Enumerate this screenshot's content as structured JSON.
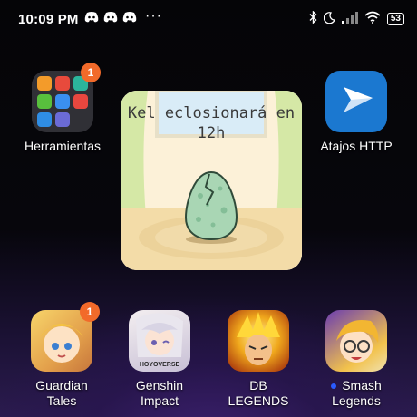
{
  "status_bar": {
    "time": "10:09 PM",
    "dots": "···",
    "battery": "53"
  },
  "apps": {
    "herramientas": {
      "label": "Herramientas",
      "badge": "1",
      "icon": "folder-icon"
    },
    "atajos": {
      "label": "Atajos HTTP",
      "icon": "play-arrow-icon"
    },
    "guardian": {
      "label": "Guardian Tales",
      "badge": "1",
      "icon": "guardian-tales-icon"
    },
    "genshin": {
      "label_line1": "Genshin",
      "label_line2": "Impact",
      "icon": "genshin-impact-icon",
      "icon_text": "HOYOVERSE"
    },
    "db": {
      "label": "DB LEGENDS",
      "icon": "db-legends-icon"
    },
    "smash": {
      "label_line1": "Smash",
      "label_line2": "Legends",
      "icon": "smash-legends-icon"
    }
  },
  "widget": {
    "line1": "Kel eclosionará en",
    "line2": "12h",
    "icon": "egg-icon"
  },
  "colors": {
    "badge": "#f26a2a",
    "widget_bg": "#fcf2dc",
    "atajos_bg": "#1b78d0"
  }
}
